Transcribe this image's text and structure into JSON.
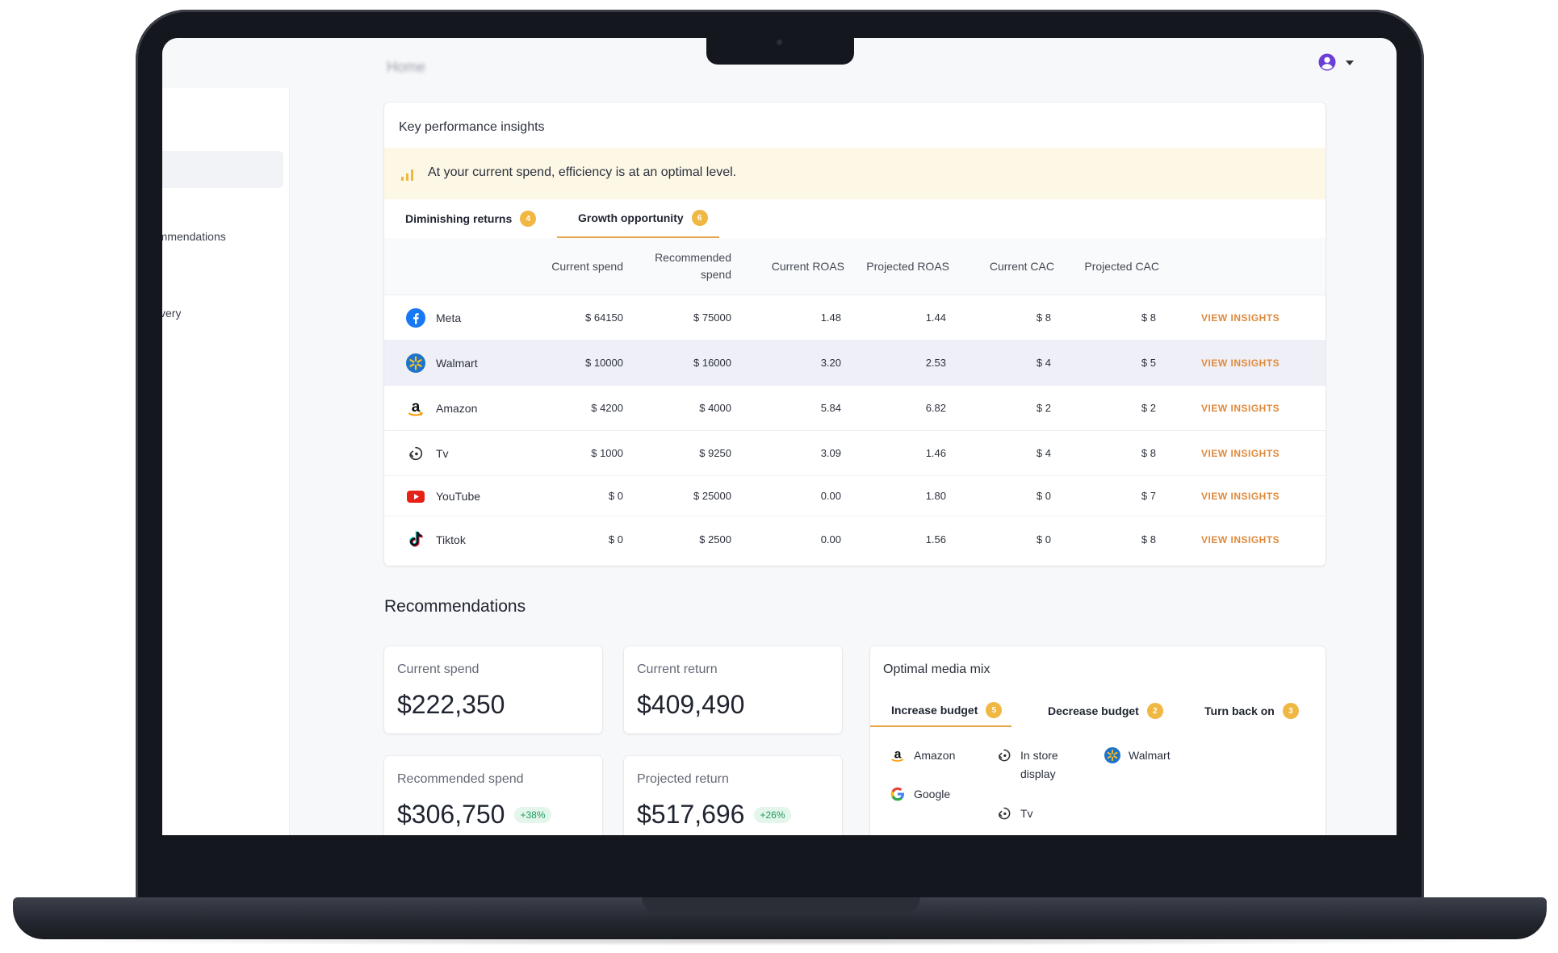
{
  "header": {
    "page_title": "Home"
  },
  "sidebar": {
    "items": [
      {
        "label": "Recommendations"
      },
      {
        "label": "Discovery"
      }
    ]
  },
  "kpi": {
    "title": "Key performance insights",
    "banner": "At your current spend, efficiency is at an optimal level.",
    "tabs": [
      {
        "label": "Diminishing returns",
        "count": "4"
      },
      {
        "label": "Growth opportunity",
        "count": "6"
      }
    ],
    "columns": [
      "Current spend",
      "Recommended spend",
      "Current ROAS",
      "Projected ROAS",
      "Current CAC",
      "Projected CAC"
    ],
    "action_label": "VIEW INSIGHTS",
    "rows": [
      {
        "channel": "Meta",
        "icon": "facebook-icon",
        "current_spend": "$ 64150",
        "recommended_spend": "$ 75000",
        "current_roas": "1.48",
        "projected_roas": "1.44",
        "current_cac": "$ 8",
        "projected_cac": "$ 8"
      },
      {
        "channel": "Walmart",
        "icon": "walmart-icon",
        "current_spend": "$ 10000",
        "recommended_spend": "$ 16000",
        "current_roas": "3.20",
        "projected_roas": "2.53",
        "current_cac": "$ 4",
        "projected_cac": "$ 5"
      },
      {
        "channel": "Amazon",
        "icon": "amazon-icon",
        "current_spend": "$ 4200",
        "recommended_spend": "$ 4000",
        "current_roas": "5.84",
        "projected_roas": "6.82",
        "current_cac": "$ 2",
        "projected_cac": "$ 2"
      },
      {
        "channel": "Tv",
        "icon": "tv-icon",
        "current_spend": "$ 1000",
        "recommended_spend": "$ 9250",
        "current_roas": "3.09",
        "projected_roas": "1.46",
        "current_cac": "$ 4",
        "projected_cac": "$ 8"
      },
      {
        "channel": "YouTube",
        "icon": "youtube-icon",
        "current_spend": "$ 0",
        "recommended_spend": "$ 25000",
        "current_roas": "0.00",
        "projected_roas": "1.80",
        "current_cac": "$ 0",
        "projected_cac": "$ 7"
      },
      {
        "channel": "Tiktok",
        "icon": "tiktok-icon",
        "current_spend": "$ 0",
        "recommended_spend": "$ 2500",
        "current_roas": "0.00",
        "projected_roas": "1.56",
        "current_cac": "$ 0",
        "projected_cac": "$ 8"
      }
    ]
  },
  "recommendations": {
    "title": "Recommendations",
    "current_spend": {
      "label": "Current spend",
      "value": "$222,350"
    },
    "current_return": {
      "label": "Current return",
      "value": "$409,490"
    },
    "recommended_spend": {
      "label": "Recommended spend",
      "value": "$306,750",
      "delta": "+38%"
    },
    "projected_return": {
      "label": "Projected return",
      "value": "$517,696",
      "delta": "+26%"
    }
  },
  "media_mix": {
    "title": "Optimal media mix",
    "tabs": [
      {
        "label": "Increase budget",
        "count": "5"
      },
      {
        "label": "Decrease budget",
        "count": "2"
      },
      {
        "label": "Turn back on",
        "count": "3"
      }
    ],
    "items": [
      {
        "label": "Amazon",
        "icon": "amazon-icon"
      },
      {
        "label": "In store display",
        "icon": "in-store-display-icon"
      },
      {
        "label": "Walmart",
        "icon": "walmart-icon"
      },
      {
        "label": "Google",
        "icon": "google-icon"
      },
      {
        "label": "Tv",
        "icon": "tv-icon"
      }
    ]
  },
  "colors": {
    "accent": "#e08a3c",
    "badge": "#f0b742",
    "positive": "#1e9a5b",
    "banner_bg": "#fdf7e6",
    "row_highlight": "#eff0f7"
  }
}
